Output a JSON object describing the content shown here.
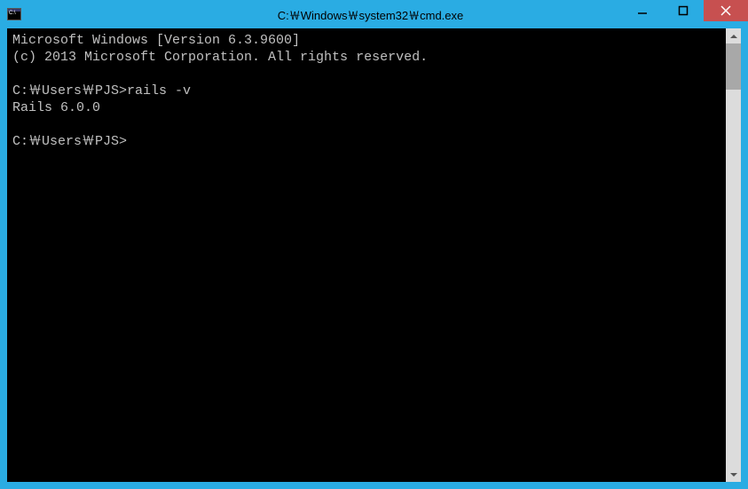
{
  "window": {
    "title": "C:￦Windows￦system32￦cmd.exe"
  },
  "icons": {
    "app_small_text": "C:\\"
  },
  "console": {
    "lines": [
      "Microsoft Windows [Version 6.3.9600]",
      "(c) 2013 Microsoft Corporation. All rights reserved.",
      "",
      "C:￦Users￦PJS>rails -v",
      "Rails 6.0.0",
      "",
      "C:￦Users￦PJS>"
    ]
  }
}
